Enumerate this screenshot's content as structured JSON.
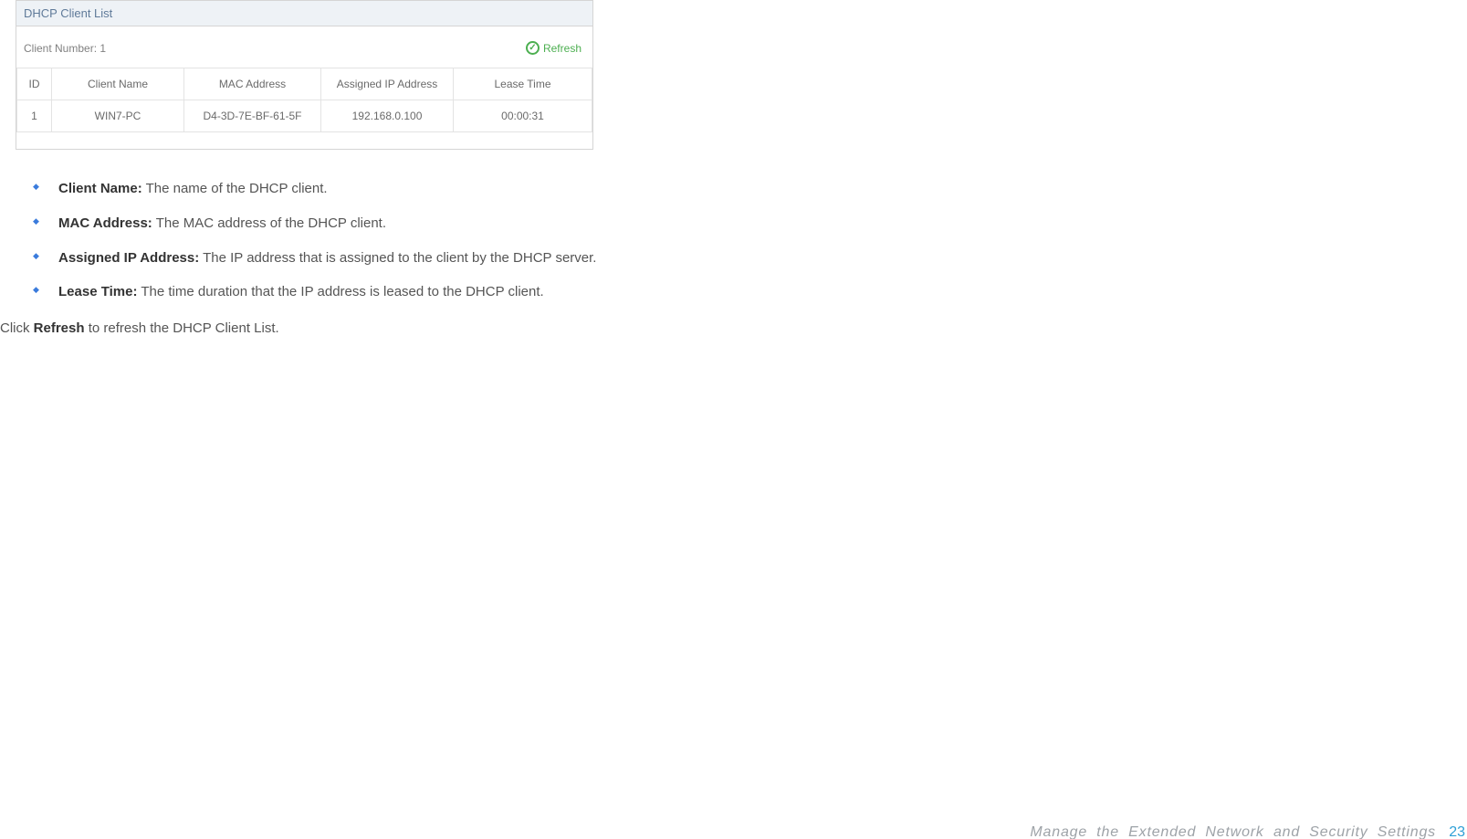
{
  "panel": {
    "title": "DHCP Client List",
    "client_number_label": "Client Number: 1",
    "refresh_label": "Refresh",
    "columns": {
      "id": "ID",
      "client_name": "Client Name",
      "mac": "MAC Address",
      "ip": "Assigned IP Address",
      "lease": "Lease Time"
    },
    "rows": [
      {
        "id": "1",
        "client_name": "WIN7-PC",
        "mac": "D4-3D-7E-BF-61-5F",
        "ip": "192.168.0.100",
        "lease": "00:00:31"
      }
    ]
  },
  "bullets": [
    {
      "term": "Client Name:",
      "desc": " The name of the DHCP client."
    },
    {
      "term": "MAC Address:",
      "desc": " The MAC address of the DHCP client."
    },
    {
      "term": "Assigned IP Address:",
      "desc": " The IP address that is assigned to the client by the DHCP server."
    },
    {
      "term": "Lease Time:",
      "desc": " The time duration that the IP address is leased to the DHCP client."
    }
  ],
  "closing": {
    "pre": "Click ",
    "bold": "Refresh",
    "post": " to refresh the DHCP Client List."
  },
  "footer": {
    "title": "Manage the Extended Network and Security Settings",
    "page": "23"
  }
}
